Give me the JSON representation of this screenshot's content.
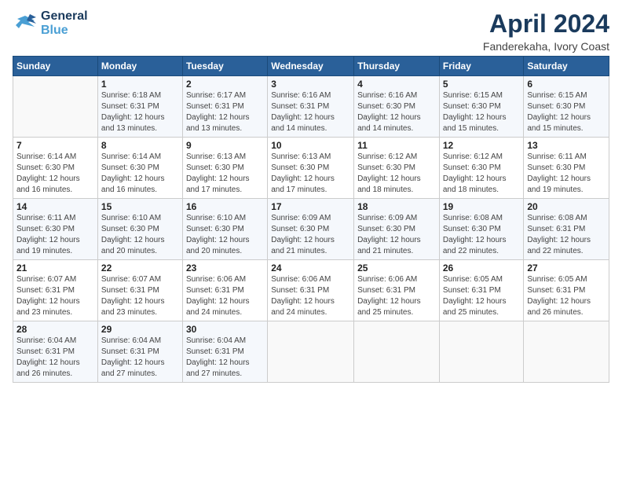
{
  "logo": {
    "line1": "General",
    "line2": "Blue"
  },
  "title": "April 2024",
  "subtitle": "Fanderekaha, Ivory Coast",
  "weekdays": [
    "Sunday",
    "Monday",
    "Tuesday",
    "Wednesday",
    "Thursday",
    "Friday",
    "Saturday"
  ],
  "weeks": [
    [
      {
        "num": "",
        "info": ""
      },
      {
        "num": "1",
        "info": "Sunrise: 6:18 AM\nSunset: 6:31 PM\nDaylight: 12 hours\nand 13 minutes."
      },
      {
        "num": "2",
        "info": "Sunrise: 6:17 AM\nSunset: 6:31 PM\nDaylight: 12 hours\nand 13 minutes."
      },
      {
        "num": "3",
        "info": "Sunrise: 6:16 AM\nSunset: 6:31 PM\nDaylight: 12 hours\nand 14 minutes."
      },
      {
        "num": "4",
        "info": "Sunrise: 6:16 AM\nSunset: 6:30 PM\nDaylight: 12 hours\nand 14 minutes."
      },
      {
        "num": "5",
        "info": "Sunrise: 6:15 AM\nSunset: 6:30 PM\nDaylight: 12 hours\nand 15 minutes."
      },
      {
        "num": "6",
        "info": "Sunrise: 6:15 AM\nSunset: 6:30 PM\nDaylight: 12 hours\nand 15 minutes."
      }
    ],
    [
      {
        "num": "7",
        "info": "Sunrise: 6:14 AM\nSunset: 6:30 PM\nDaylight: 12 hours\nand 16 minutes."
      },
      {
        "num": "8",
        "info": "Sunrise: 6:14 AM\nSunset: 6:30 PM\nDaylight: 12 hours\nand 16 minutes."
      },
      {
        "num": "9",
        "info": "Sunrise: 6:13 AM\nSunset: 6:30 PM\nDaylight: 12 hours\nand 17 minutes."
      },
      {
        "num": "10",
        "info": "Sunrise: 6:13 AM\nSunset: 6:30 PM\nDaylight: 12 hours\nand 17 minutes."
      },
      {
        "num": "11",
        "info": "Sunrise: 6:12 AM\nSunset: 6:30 PM\nDaylight: 12 hours\nand 18 minutes."
      },
      {
        "num": "12",
        "info": "Sunrise: 6:12 AM\nSunset: 6:30 PM\nDaylight: 12 hours\nand 18 minutes."
      },
      {
        "num": "13",
        "info": "Sunrise: 6:11 AM\nSunset: 6:30 PM\nDaylight: 12 hours\nand 19 minutes."
      }
    ],
    [
      {
        "num": "14",
        "info": "Sunrise: 6:11 AM\nSunset: 6:30 PM\nDaylight: 12 hours\nand 19 minutes."
      },
      {
        "num": "15",
        "info": "Sunrise: 6:10 AM\nSunset: 6:30 PM\nDaylight: 12 hours\nand 20 minutes."
      },
      {
        "num": "16",
        "info": "Sunrise: 6:10 AM\nSunset: 6:30 PM\nDaylight: 12 hours\nand 20 minutes."
      },
      {
        "num": "17",
        "info": "Sunrise: 6:09 AM\nSunset: 6:30 PM\nDaylight: 12 hours\nand 21 minutes."
      },
      {
        "num": "18",
        "info": "Sunrise: 6:09 AM\nSunset: 6:30 PM\nDaylight: 12 hours\nand 21 minutes."
      },
      {
        "num": "19",
        "info": "Sunrise: 6:08 AM\nSunset: 6:30 PM\nDaylight: 12 hours\nand 22 minutes."
      },
      {
        "num": "20",
        "info": "Sunrise: 6:08 AM\nSunset: 6:31 PM\nDaylight: 12 hours\nand 22 minutes."
      }
    ],
    [
      {
        "num": "21",
        "info": "Sunrise: 6:07 AM\nSunset: 6:31 PM\nDaylight: 12 hours\nand 23 minutes."
      },
      {
        "num": "22",
        "info": "Sunrise: 6:07 AM\nSunset: 6:31 PM\nDaylight: 12 hours\nand 23 minutes."
      },
      {
        "num": "23",
        "info": "Sunrise: 6:06 AM\nSunset: 6:31 PM\nDaylight: 12 hours\nand 24 minutes."
      },
      {
        "num": "24",
        "info": "Sunrise: 6:06 AM\nSunset: 6:31 PM\nDaylight: 12 hours\nand 24 minutes."
      },
      {
        "num": "25",
        "info": "Sunrise: 6:06 AM\nSunset: 6:31 PM\nDaylight: 12 hours\nand 25 minutes."
      },
      {
        "num": "26",
        "info": "Sunrise: 6:05 AM\nSunset: 6:31 PM\nDaylight: 12 hours\nand 25 minutes."
      },
      {
        "num": "27",
        "info": "Sunrise: 6:05 AM\nSunset: 6:31 PM\nDaylight: 12 hours\nand 26 minutes."
      }
    ],
    [
      {
        "num": "28",
        "info": "Sunrise: 6:04 AM\nSunset: 6:31 PM\nDaylight: 12 hours\nand 26 minutes."
      },
      {
        "num": "29",
        "info": "Sunrise: 6:04 AM\nSunset: 6:31 PM\nDaylight: 12 hours\nand 27 minutes."
      },
      {
        "num": "30",
        "info": "Sunrise: 6:04 AM\nSunset: 6:31 PM\nDaylight: 12 hours\nand 27 minutes."
      },
      {
        "num": "",
        "info": ""
      },
      {
        "num": "",
        "info": ""
      },
      {
        "num": "",
        "info": ""
      },
      {
        "num": "",
        "info": ""
      }
    ]
  ]
}
